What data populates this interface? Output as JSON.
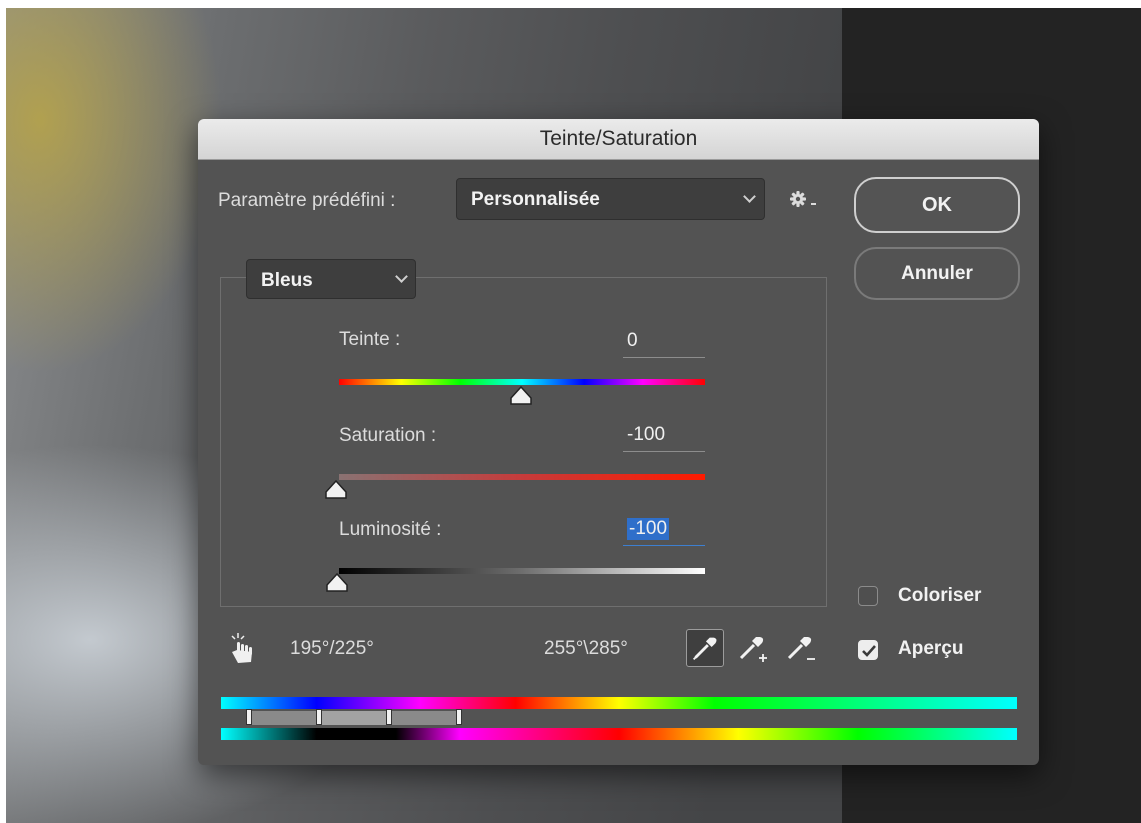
{
  "dialog": {
    "title": "Teinte/Saturation",
    "preset_label": "Paramètre prédéfini :",
    "preset_value": "Personnalisée",
    "ok_label": "OK",
    "cancel_label": "Annuler",
    "channel_value": "Bleus",
    "sliders": [
      {
        "label": "Teinte :",
        "value": "0",
        "position": 0.5
      },
      {
        "label": "Saturation :",
        "value": "-100",
        "position": 0.0
      },
      {
        "label": "Luminosité :",
        "value": "-100",
        "position": 0.0
      }
    ],
    "colorize_label": "Coloriser",
    "colorize_checked": false,
    "preview_label": "Aperçu",
    "preview_checked": true,
    "range_left": "195°/225°",
    "range_right": "255°\\285°"
  },
  "icons": {
    "settings": "gear-icon",
    "target_adjust": "hand-target-icon",
    "eyedropper": "eyedropper-icon",
    "eyedropper_add": "eyedropper-plus-icon",
    "eyedropper_subtract": "eyedropper-minus-icon"
  },
  "colors": {
    "dialog_bg": "#535353",
    "selection": "#2f6fca"
  }
}
